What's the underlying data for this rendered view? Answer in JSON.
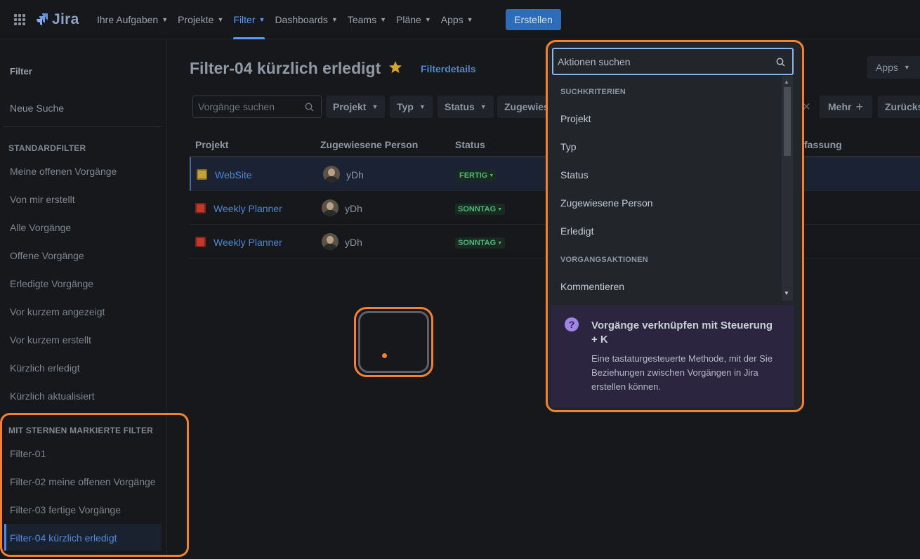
{
  "nav": {
    "logo_text": "Jira",
    "items": [
      {
        "label": "Ihre Aufgaben"
      },
      {
        "label": "Projekte"
      },
      {
        "label": "Filter"
      },
      {
        "label": "Dashboards"
      },
      {
        "label": "Teams"
      },
      {
        "label": "Pläne"
      },
      {
        "label": "Apps"
      }
    ],
    "create_label": "Erstellen"
  },
  "sidebar": {
    "title": "Filter",
    "new_search": "Neue Suche",
    "standard_heading": "STANDARDFILTER",
    "standard_items": [
      "Meine offenen Vorgänge",
      "Von mir erstellt",
      "Alle Vorgänge",
      "Offene Vorgänge",
      "Erledigte Vorgänge",
      "Vor kurzem angezeigt",
      "Vor kurzem erstellt",
      "Kürzlich erledigt",
      "Kürzlich aktualisiert"
    ],
    "starred_heading": "MIT STERNEN MARKIERTE FILTER",
    "starred_items": [
      "Filter-01",
      "Filter-02 meine offenen Vorgänge",
      "Filter-03 fertige Vorgänge",
      "Filter-04 kürzlich erledigt"
    ]
  },
  "main": {
    "title": "Filter-04 kürzlich erledigt",
    "filter_details": "Filterdetails",
    "apps_label": "Apps",
    "search_placeholder": "Vorgänge suchen",
    "chips": [
      "Projekt",
      "Typ",
      "Status",
      "Zugewies"
    ],
    "more_label": "Mehr",
    "back_label": "Zurücks",
    "columns": [
      "Projekt",
      "Zugewiesene Person",
      "Status",
      "fassung"
    ],
    "rows": [
      {
        "project": "WebSite",
        "assignee": "yDh",
        "status": "FERTIG"
      },
      {
        "project": "Weekly Planner",
        "assignee": "yDh",
        "status": "SONNTAG"
      },
      {
        "project": "Weekly Planner",
        "assignee": "yDh",
        "status": "SONNTAG"
      }
    ]
  },
  "panel": {
    "search_placeholder": "Aktionen suchen",
    "group1": "SUCHKRITERIEN",
    "group1_items": [
      "Projekt",
      "Typ",
      "Status",
      "Zugewiesene Person",
      "Erledigt"
    ],
    "group2": "VORGANGSAKTIONEN",
    "group2_items": [
      "Kommentieren"
    ],
    "tip_title": "Vorgänge verknüpfen mit Steuerung + K",
    "tip_body": "Eine tastaturgesteuerte Methode, mit der Sie Beziehungen zwischen Vorgängen in Jira erstellen können."
  },
  "colors": {
    "accent": "#579dff",
    "highlight": "#f3812d",
    "status_green": "#4bb876"
  }
}
